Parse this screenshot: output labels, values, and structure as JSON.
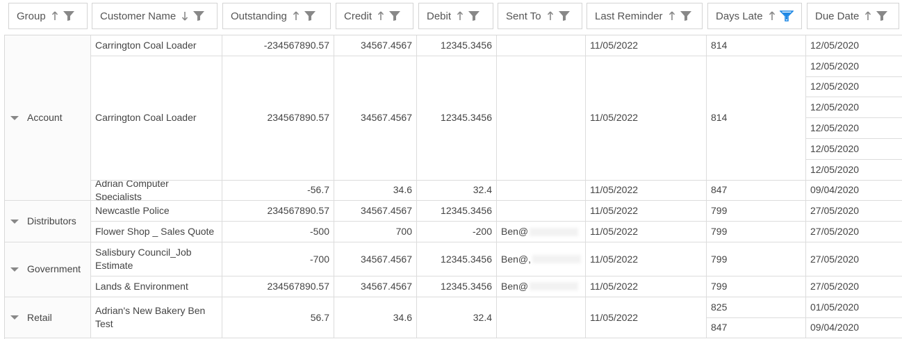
{
  "header": {
    "columns": [
      {
        "label": "Group",
        "sort": "asc",
        "filtered": false
      },
      {
        "label": "Customer Name",
        "sort": "desc",
        "filtered": false
      },
      {
        "label": "Outstanding",
        "sort": "asc",
        "filtered": false
      },
      {
        "label": "Credit",
        "sort": "asc",
        "filtered": false
      },
      {
        "label": "Debit",
        "sort": "asc",
        "filtered": false
      },
      {
        "label": "Sent To",
        "sort": "asc",
        "filtered": false
      },
      {
        "label": "Last Reminder",
        "sort": "asc",
        "filtered": false
      },
      {
        "label": "Days Late",
        "sort": "asc",
        "filtered": true
      },
      {
        "label": "Due Date",
        "sort": "asc",
        "filtered": false
      }
    ]
  },
  "colors": {
    "filter_active": "#1e88e5",
    "icon": "#888888"
  },
  "groups": [
    {
      "name": "Account",
      "customers": [
        {
          "name": "Carrington Coal Loader",
          "outstanding": "-234567890.57",
          "credit": "34567.4567",
          "debit": "12345.3456",
          "sent_to": "",
          "last_reminder": "11/05/2022",
          "days_late": "814",
          "due_dates": [
            "12/05/2020"
          ]
        },
        {
          "name": "Carrington Coal Loader",
          "outstanding": "234567890.57",
          "credit": "34567.4567",
          "debit": "12345.3456",
          "sent_to": "",
          "last_reminder": "11/05/2022",
          "days_late": "814",
          "due_dates": [
            "12/05/2020",
            "12/05/2020",
            "12/05/2020",
            "12/05/2020",
            "12/05/2020",
            "12/05/2020"
          ]
        },
        {
          "name": "Adrian Computer Specialists",
          "outstanding": "-56.7",
          "credit": "34.6",
          "debit": "32.4",
          "sent_to": "",
          "last_reminder": "11/05/2022",
          "days_late": "847",
          "due_dates": [
            "09/04/2020"
          ]
        }
      ]
    },
    {
      "name": "Distributors",
      "customers": [
        {
          "name": "Newcastle Police",
          "outstanding": "234567890.57",
          "credit": "34567.4567",
          "debit": "12345.3456",
          "sent_to": "",
          "last_reminder": "11/05/2022",
          "days_late": "799",
          "due_dates": [
            "27/05/2020"
          ]
        },
        {
          "name": "Flower Shop _ Sales Quote",
          "outstanding": "-500",
          "credit": "700",
          "debit": "-200",
          "sent_to": "Ben@",
          "last_reminder": "11/05/2022",
          "days_late": "799",
          "due_dates": [
            "27/05/2020"
          ]
        }
      ]
    },
    {
      "name": "Government",
      "customers": [
        {
          "name": "Salisbury Council_Job Estimate",
          "outstanding": "-700",
          "credit": "34567.4567",
          "debit": "12345.3456",
          "sent_to": "Ben@,",
          "last_reminder": "11/05/2022",
          "days_late": "799",
          "due_dates": [
            "27/05/2020"
          ]
        },
        {
          "name": "Lands & Environment",
          "outstanding": "234567890.57",
          "credit": "34567.4567",
          "debit": "12345.3456",
          "sent_to": "Ben@",
          "last_reminder": "11/05/2022",
          "days_late": "799",
          "due_dates": [
            "27/05/2020"
          ]
        }
      ]
    },
    {
      "name": "Retail",
      "customers": [
        {
          "name": "Adrian's New Bakery Ben Test",
          "outstanding": "56.7",
          "credit": "34.6",
          "debit": "32.4",
          "sent_to": "",
          "last_reminder": "11/05/2022",
          "days_late_list": [
            "825",
            "847"
          ],
          "due_dates": [
            "01/05/2020",
            "09/04/2020"
          ]
        }
      ]
    }
  ]
}
